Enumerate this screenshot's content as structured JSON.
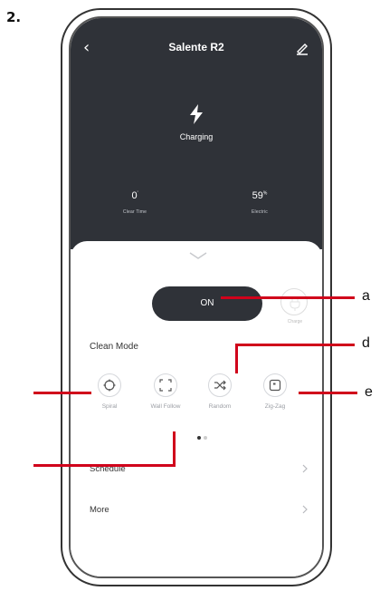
{
  "step_number": "2.",
  "app": {
    "title": "Salente R2",
    "status": "Charging",
    "stats": [
      {
        "value": "0",
        "unit": "'",
        "label": "Clear Time"
      },
      {
        "value": "59",
        "unit": "%",
        "label": "Electric"
      }
    ],
    "power_button_label": "ON",
    "charge_button_label": "Charge",
    "clean_mode_title": "Clean Mode",
    "modes": [
      {
        "label": "Spiral",
        "icon": "spiral-icon"
      },
      {
        "label": "Wall Follow",
        "icon": "wall-follow-icon"
      },
      {
        "label": "Random",
        "icon": "random-icon"
      },
      {
        "label": "Zig-Zag",
        "icon": "zigzag-icon"
      }
    ],
    "rows": [
      {
        "label": "Schedule"
      },
      {
        "label": "More"
      }
    ]
  },
  "callouts": {
    "a": "a",
    "d": "d",
    "e": "e"
  },
  "colors": {
    "dark_panel": "#2f3238",
    "callout": "#d0021b"
  }
}
